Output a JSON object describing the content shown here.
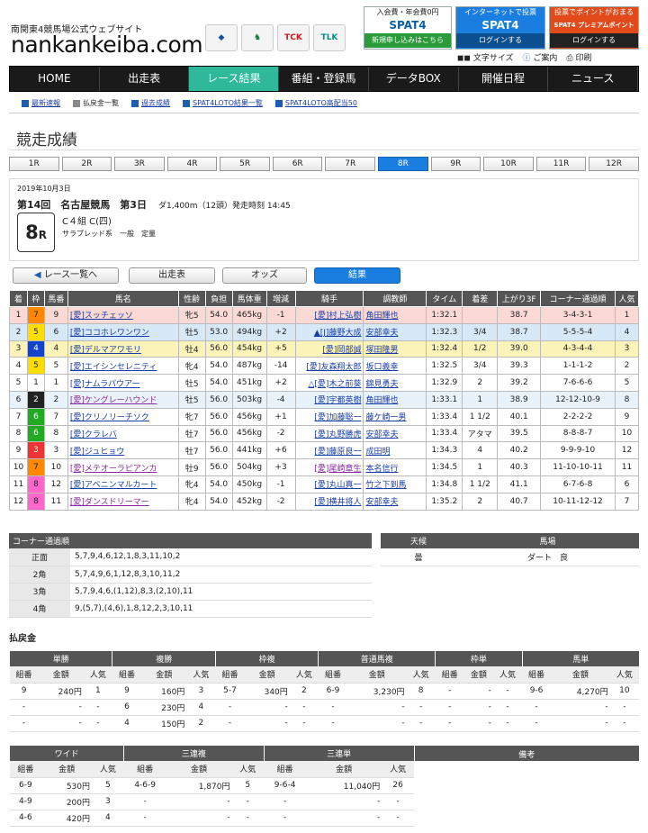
{
  "header": {
    "subtitle": "南関東4競馬場公式ウェブサイト",
    "site_name": "nankankeiba.com",
    "logos": [
      "TCK",
      "TLK"
    ],
    "banners": [
      {
        "top": "入会費・年会費0円",
        "main": "SPAT4",
        "bottom": "新規申し込みはこちら"
      },
      {
        "top": "インターネットで投票",
        "main": "SPAT4",
        "bottom": "ログインする"
      },
      {
        "top": "投票でポイントがおまる",
        "main": "SPAT4 プレミアムポイント",
        "bottom": "ログインする"
      }
    ],
    "tools": [
      "文字サイズ",
      "ご案内",
      "印刷"
    ]
  },
  "nav": [
    "HOME",
    "出走表",
    "レース結果",
    "番組・登録馬",
    "データBOX",
    "開催日程",
    "ニュース"
  ],
  "subnav": [
    "最新速報",
    "払戻金一覧",
    "過去成績",
    "SPAT4LOTO結果一覧",
    "SPAT4LOTO高配当50"
  ],
  "page_title": "競走成績",
  "race_tabs": [
    "1R",
    "2R",
    "3R",
    "4R",
    "5R",
    "6R",
    "7R",
    "8R",
    "9R",
    "10R",
    "11R",
    "12R"
  ],
  "race": {
    "date": "2019年10月3日",
    "meeting": "第14回　名古屋競馬　第3日",
    "distance": "ダ1,400m（12頭）発走時刻 14:45",
    "number": "8",
    "number_suffix": "R",
    "class": "C４組 C(四)",
    "conditions": "サラブレッド系　一般　定量"
  },
  "buttons": {
    "back": "レース一覧へ",
    "entries": "出走表",
    "odds": "オッズ",
    "results": "結果"
  },
  "results": {
    "headers": [
      "着",
      "枠",
      "馬番",
      "馬名",
      "性齢",
      "負担",
      "馬体重",
      "増減",
      "騎手",
      "調教師",
      "タイム",
      "着差",
      "上がり3F",
      "コーナー通過順",
      "人気"
    ],
    "rows": [
      [
        "1",
        "7",
        "9",
        "[愛]スッチェッソ",
        "牝5",
        "54.0",
        "465kg",
        "-1",
        "[愛]村上弘樹",
        "角田輝也",
        "1:32.1",
        "",
        "38.7",
        "3-4-3-1",
        "1"
      ],
      [
        "2",
        "5",
        "6",
        "[愛]ココホレワンワン",
        "牡5",
        "53.0",
        "494kg",
        "+2",
        "▲[J]藤野大成",
        "安部幸夫",
        "1:32.3",
        "3/4",
        "38.7",
        "5-5-5-4",
        "4"
      ],
      [
        "3",
        "4",
        "4",
        "[愛]デルマアワモリ",
        "牡4",
        "56.0",
        "454kg",
        "+5",
        "[愛]岡部誠",
        "塚田隆男",
        "1:32.4",
        "1/2",
        "39.0",
        "4-3-4-4",
        "3"
      ],
      [
        "4",
        "5",
        "5",
        "[愛]エイシンセレニティ",
        "牝4",
        "54.0",
        "487kg",
        "-14",
        "[愛]友森翔太郎",
        "坂口義幸",
        "1:32.5",
        "3/4",
        "39.3",
        "1-1-1-2",
        "2"
      ],
      [
        "5",
        "1",
        "1",
        "[愛]ナムラパウアー",
        "牡5",
        "54.0",
        "451kg",
        "+2",
        "△[愛]木之前葵",
        "錦見勇夫",
        "1:32.9",
        "2",
        "39.2",
        "7-6-6-6",
        "5"
      ],
      [
        "6",
        "2",
        "2",
        "[愛]ケングレーハウンド",
        "牡5",
        "56.0",
        "503kg",
        "-4",
        "[愛]宇都英樹",
        "角田輝也",
        "1:33.1",
        "1",
        "38.9",
        "12-12-10-9",
        "8"
      ],
      [
        "7",
        "6",
        "7",
        "[愛]クリノリーチソク",
        "牝7",
        "56.0",
        "456kg",
        "+1",
        "[愛]加藤聡一",
        "藤ケ崎一男",
        "1:33.4",
        "1 1/2",
        "40.1",
        "2-2-2-2",
        "9"
      ],
      [
        "8",
        "6",
        "8",
        "[愛]クラレバ",
        "牡7",
        "56.0",
        "456kg",
        "-2",
        "[愛]丸野勝虎",
        "安部幸夫",
        "1:33.4",
        "アタマ",
        "39.5",
        "8-8-8-7",
        "10"
      ],
      [
        "9",
        "3",
        "3",
        "[愛]ジュヒョウ",
        "牡7",
        "56.0",
        "441kg",
        "+6",
        "[愛]藤原良一",
        "成田明",
        "1:34.3",
        "4",
        "40.2",
        "9-9-9-10",
        "12"
      ],
      [
        "10",
        "7",
        "10",
        "[愛]メテオーラピアンカ",
        "牡9",
        "56.0",
        "504kg",
        "+3",
        "[愛]尾崎章生",
        "本名信行",
        "1:34.5",
        "1",
        "40.3",
        "11-10-10-11",
        "11"
      ],
      [
        "11",
        "8",
        "12",
        "[愛]アベニンマルカート",
        "牝4",
        "54.0",
        "450kg",
        "-1",
        "[愛]丸山真一",
        "竹之下到馬",
        "1:34.8",
        "1 1/2",
        "41.1",
        "6-7-6-8",
        "6"
      ],
      [
        "12",
        "8",
        "11",
        "[愛]ダンスドリーマー",
        "牝4",
        "54.0",
        "452kg",
        "-2",
        "[愛]横井将人",
        "安部幸夫",
        "1:35.2",
        "2",
        "40.7",
        "10-11-12-12",
        "7"
      ]
    ]
  },
  "corners": {
    "title": "コーナー通過順",
    "rows": [
      [
        "正面",
        "5,7,9,4,6,12,1,8,3,11,10,2"
      ],
      [
        "2角",
        "5,7,4,9,6,1,12,8,3,10,11,2"
      ],
      [
        "3角",
        "5,7,9,4,6,(1,12),8,3,(2,10),11"
      ],
      [
        "4角",
        "9,(5,7),(4,6),1,8,12,2,3,10,11"
      ]
    ]
  },
  "weather": {
    "h_weather": "天候",
    "h_track": "馬場",
    "weather": "曇",
    "track": "ダート　良"
  },
  "payout_title": "払戻金",
  "payout1": {
    "groups": [
      "単勝",
      "複勝",
      "枠複",
      "普通馬複",
      "枠単",
      "馬単"
    ],
    "sub": [
      "組番",
      "金額",
      "人気"
    ],
    "rows": [
      [
        "9",
        "240円",
        "1",
        "9",
        "160円",
        "3",
        "5-7",
        "340円",
        "2",
        "6-9",
        "3,230円",
        "8",
        "-",
        "-",
        "-",
        "9-6",
        "4,270円",
        "10"
      ],
      [
        "-",
        "-",
        "-",
        "6",
        "230円",
        "4",
        "-",
        "-",
        "-",
        "-",
        "-",
        "-",
        "-",
        "-",
        "-",
        "-",
        "-",
        "-"
      ],
      [
        "-",
        "-",
        "-",
        "4",
        "150円",
        "2",
        "-",
        "-",
        "-",
        "-",
        "-",
        "-",
        "-",
        "-",
        "-",
        "-",
        "-",
        "-"
      ]
    ]
  },
  "payout2": {
    "groups": [
      "ワイド",
      "三連複",
      "三連単",
      "備考"
    ],
    "sub": [
      "組番",
      "金額",
      "人気"
    ],
    "rows": [
      [
        "6-9",
        "530円",
        "5",
        "4-6-9",
        "1,870円",
        "5",
        "9-6-4",
        "11,040円",
        "26"
      ],
      [
        "4-9",
        "200円",
        "3",
        "-",
        "-",
        "-",
        "-",
        "-",
        "-"
      ],
      [
        "4-6",
        "420円",
        "4",
        "-",
        "-",
        "-",
        "-",
        "-",
        "-"
      ]
    ]
  }
}
